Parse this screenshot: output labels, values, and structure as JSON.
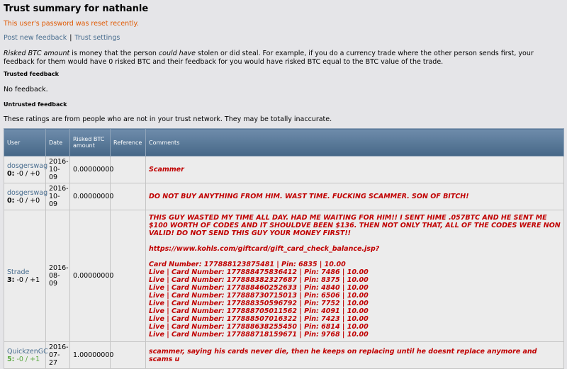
{
  "page": {
    "title": "Trust summary for nathanle",
    "notice": "This user's password was reset recently.",
    "links": {
      "post_feedback": "Post new feedback",
      "separator": "|",
      "trust_settings": "Trust settings"
    },
    "desc_em1": "Risked BTC amount",
    "desc_t1": " is money that the person ",
    "desc_em2": "could have",
    "desc_t2": " stolen or did steal. For example, if you do a currency trade where the other person sends first, your feedback for them would have 0 risked BTC and their feedback for you would have risked BTC equal to the BTC value of the trade.",
    "trusted_heading": "Trusted feedback",
    "no_feedback": "No feedback.",
    "untrusted_heading": "Untrusted feedback",
    "untrusted_note": "These ratings are from people who are not in your trust network. They may be totally inaccurate."
  },
  "table": {
    "headers": {
      "user": "User",
      "date": "Date",
      "risked": "Risked BTC amount",
      "reference": "Reference",
      "comments": "Comments"
    },
    "rows": [
      {
        "user": "dosgerswag",
        "score": "0:",
        "score_rest": "-0 / +0",
        "date_a": "2016-",
        "date_b": "10-09",
        "risked": "0.00000000",
        "reference": "",
        "comment": [
          "Scammer"
        ]
      },
      {
        "user": "dosgerswag",
        "score": "0:",
        "score_rest": "-0 / +0",
        "date_a": "2016-",
        "date_b": "10-09",
        "risked": "0.00000000",
        "reference": "",
        "comment": [
          "DO NOT BUY ANYTHING FROM HIM. WAST TIME. FUCKING SCAMMER. SON OF BITCH!"
        ]
      },
      {
        "user": "Strade",
        "score": "3:",
        "score_rest": "-0 / +1",
        "date_a": "2016-",
        "date_b": "08-09",
        "risked": "0.00000000",
        "reference": "",
        "comment": [
          "THIS GUY WASTED MY TIME ALL DAY. HAD ME WAITING FOR HIM!! I SENT HIME .057BTC AND HE SENT ME $100 WORTH OF CODES AND IT SHOULDVE BEEN $136. THEN NOT ONLY THAT, ALL OF THE CODES WERE NON VALID! DO NOT SEND THIS GUY YOUR MONEY FIRST!!",
          "",
          "https://www.kohls.com/giftcard/gift_card_check_balance.jsp?",
          "",
          "Card Number: 177888123875481 | Pin: 6835 | 10.00",
          "Live | Card Number: 177888475836412 | Pin: 7486 | 10.00",
          "Live | Card Number: 177888382327687 | Pin: 8375 | 10.00",
          "Live | Card Number: 177888460252633 | Pin: 4840 | 10.00",
          "Live | Card Number: 177888730715013 | Pin: 6506 | 10.00",
          "Live | Card Number: 177888350596792 | Pin: 7752 | 10.00",
          "Live | Card Number: 177888705011562 | Pin: 4091 | 10.00",
          "Live | Card Number: 177888507016322 | Pin: 7423 | 10.00",
          "Live | Card Number: 177888638255450 | Pin: 6814 | 10.00",
          "Live | Card Number: 177888718159671 | Pin: 9768 | 10.00"
        ]
      },
      {
        "user": "QuickzenGC",
        "score": "5:",
        "score_rest": "-0 / +1",
        "green": true,
        "date_a": "2016-",
        "date_b": "07-27",
        "risked": "1.00000000",
        "reference": "",
        "comment": [
          "scammer, saying his cards never die, then he keeps on replacing until he doesnt replace anymore and scams u"
        ]
      }
    ]
  }
}
